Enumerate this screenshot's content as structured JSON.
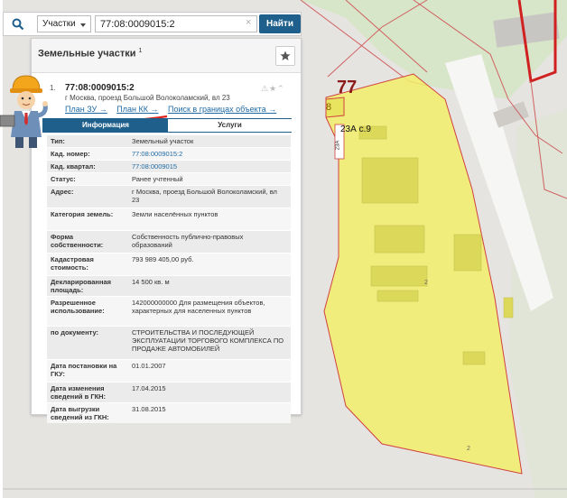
{
  "search": {
    "type_label": "Участки",
    "query": "77:08:0009015:2",
    "find_label": "Найти"
  },
  "panel": {
    "title": "Земельные участки",
    "title_sup": "1"
  },
  "result": {
    "index": "1.",
    "number": "77:08:0009015:2",
    "address": "г Москва, проезд Большой Волоколамский, вл 23",
    "links": [
      "План ЗУ →",
      "План КК →",
      "Поиск в границах объекта →"
    ]
  },
  "tabs": {
    "info": "Информация",
    "services": "Услуги"
  },
  "attributes": [
    {
      "key": "Тип:",
      "value": "Земельный участок"
    },
    {
      "key": "Кад. номер:",
      "value": "77:08:0009015:2",
      "link": true
    },
    {
      "key": "Кад. квартал:",
      "value": "77:08:0009015",
      "link": true
    },
    {
      "key": "Статус:",
      "value": "Ранее учтенный"
    },
    {
      "key": "Адрес:",
      "value": "г Москва, проезд Большой Волоколамский, вл 23"
    },
    {
      "key": "Категория земель:",
      "value": "Земли населённых пунктов"
    },
    {
      "key": "Форма собственности:",
      "value": "Собственность публично-правовых образований"
    },
    {
      "key": "Кадастровая стоимость:",
      "value": "793 989 405,00 руб."
    },
    {
      "key": "Декларированная площадь:",
      "value": "14 500 кв. м"
    },
    {
      "key": "Разрешенное использование:",
      "value": "142000000000 Для размещения объектов, характерных для населенных пунктов"
    },
    {
      "key": "по документу:",
      "value": "СТРОИТЕЛЬСТВА И ПОСЛЕДУЮЩЕЙ ЭКСПЛУАТАЦИИ ТОРГОВОГО КОМПЛЕКСА ПО ПРОДАЖЕ АВТОМОБИЛЕЙ"
    },
    {
      "key": "Дата постановки на ГКУ:",
      "value": "01.01.2007"
    },
    {
      "key": "Дата изменения сведений в ГКН:",
      "value": "17.04.2015"
    },
    {
      "key": "Дата выгрузки сведений из ГКН:",
      "value": "31.08.2015"
    }
  ],
  "map": {
    "district_label": "77",
    "parcel_label_8": "8",
    "building_label": "23А с.9",
    "vertical_label": "23А",
    "small_label_1": "2",
    "small_label_2": "2",
    "parcel_color": "#f2ee6a",
    "boundary_color": "#d04040"
  }
}
